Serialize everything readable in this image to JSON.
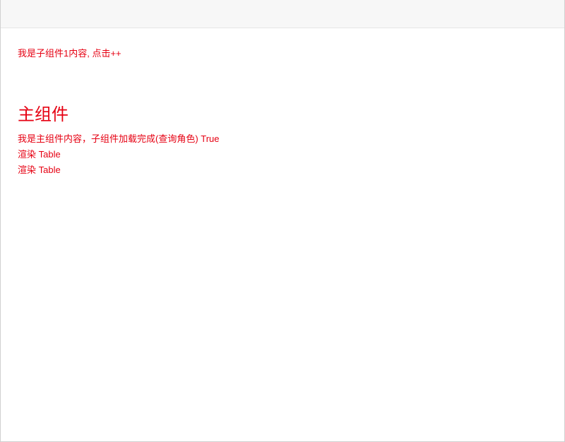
{
  "child": {
    "text": "我是子组件1内容, 点击++"
  },
  "main": {
    "heading": "主组件",
    "info_line": "我是主组件内容，子组件加载完成(查询角色) True",
    "render_line_1": "渲染 Table",
    "render_line_2": "渲染 Table"
  }
}
